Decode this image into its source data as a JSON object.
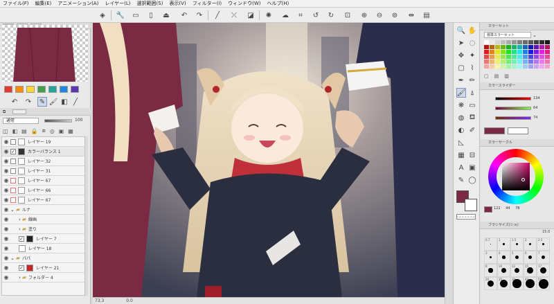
{
  "menu": [
    "ファイル(F)",
    "編集(E)",
    "アニメーション(A)",
    "レイヤー(L)",
    "選択範囲(S)",
    "表示(V)",
    "フィルター(I)",
    "ウィンドウ(W)",
    "ヘルプ(H)"
  ],
  "layers": {
    "blend_mode": "通常",
    "opacity": "100",
    "rows": [
      {
        "name": "レイヤー 19",
        "kind": "raster"
      },
      {
        "name": "カラーバランス 1",
        "kind": "correction"
      },
      {
        "name": "レイヤー 32",
        "kind": "raster"
      },
      {
        "name": "レイヤー 31",
        "kind": "raster"
      },
      {
        "name": "レイヤー 67",
        "kind": "raster"
      },
      {
        "name": "レイヤー 66",
        "kind": "raster"
      },
      {
        "name": "レイヤー 67",
        "kind": "raster"
      },
      {
        "name": "ルナ",
        "kind": "folder"
      },
      {
        "name": "線画",
        "kind": "folder"
      },
      {
        "name": "塗り",
        "kind": "folder"
      },
      {
        "name": "レイヤー 7",
        "kind": "raster"
      },
      {
        "name": "レイヤー 18",
        "kind": "raster"
      },
      {
        "name": "パパ",
        "kind": "folder"
      },
      {
        "name": "レイヤー 21",
        "kind": "raster"
      },
      {
        "name": "フォルダー 4",
        "kind": "folder"
      }
    ]
  },
  "statusbar": {
    "zoom": "73.3",
    "angle": "0.0"
  },
  "colorset": {
    "title": "カラーセット",
    "selected": "標準カラーセット"
  },
  "colorslider": {
    "title": "カラースライダー",
    "r": "134",
    "g": "64",
    "b": "74"
  },
  "colorwheel": {
    "title": "カラーサークル",
    "h": "122",
    "s": "44",
    "v": "78"
  },
  "brushsize": {
    "title": "ブラシサイズ(ショ)",
    "current": "15.0",
    "labels": [
      "0.7",
      "1",
      "1.5",
      "2",
      "2.5",
      "3",
      "4",
      "5",
      "6",
      "7",
      "8",
      "10",
      "12",
      "15",
      "17",
      "20",
      "25",
      "30",
      "40",
      "50"
    ]
  },
  "colors": {
    "main": "#7a2a42",
    "sub": "#ffffff",
    "accent": "#4a6fb5"
  }
}
